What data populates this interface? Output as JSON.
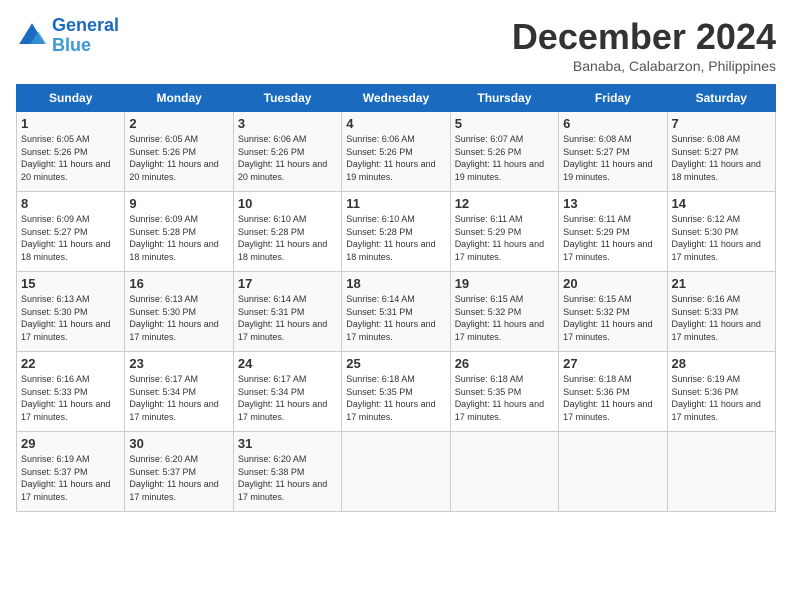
{
  "header": {
    "logo_line1": "General",
    "logo_line2": "Blue",
    "month_title": "December 2024",
    "location": "Banaba, Calabarzon, Philippines"
  },
  "days_of_week": [
    "Sunday",
    "Monday",
    "Tuesday",
    "Wednesday",
    "Thursday",
    "Friday",
    "Saturday"
  ],
  "weeks": [
    [
      {
        "day": "1",
        "sunrise": "6:05 AM",
        "sunset": "5:26 PM",
        "daylight": "11 hours and 20 minutes."
      },
      {
        "day": "2",
        "sunrise": "6:05 AM",
        "sunset": "5:26 PM",
        "daylight": "11 hours and 20 minutes."
      },
      {
        "day": "3",
        "sunrise": "6:06 AM",
        "sunset": "5:26 PM",
        "daylight": "11 hours and 20 minutes."
      },
      {
        "day": "4",
        "sunrise": "6:06 AM",
        "sunset": "5:26 PM",
        "daylight": "11 hours and 19 minutes."
      },
      {
        "day": "5",
        "sunrise": "6:07 AM",
        "sunset": "5:26 PM",
        "daylight": "11 hours and 19 minutes."
      },
      {
        "day": "6",
        "sunrise": "6:08 AM",
        "sunset": "5:27 PM",
        "daylight": "11 hours and 19 minutes."
      },
      {
        "day": "7",
        "sunrise": "6:08 AM",
        "sunset": "5:27 PM",
        "daylight": "11 hours and 18 minutes."
      }
    ],
    [
      {
        "day": "8",
        "sunrise": "6:09 AM",
        "sunset": "5:27 PM",
        "daylight": "11 hours and 18 minutes."
      },
      {
        "day": "9",
        "sunrise": "6:09 AM",
        "sunset": "5:28 PM",
        "daylight": "11 hours and 18 minutes."
      },
      {
        "day": "10",
        "sunrise": "6:10 AM",
        "sunset": "5:28 PM",
        "daylight": "11 hours and 18 minutes."
      },
      {
        "day": "11",
        "sunrise": "6:10 AM",
        "sunset": "5:28 PM",
        "daylight": "11 hours and 18 minutes."
      },
      {
        "day": "12",
        "sunrise": "6:11 AM",
        "sunset": "5:29 PM",
        "daylight": "11 hours and 17 minutes."
      },
      {
        "day": "13",
        "sunrise": "6:11 AM",
        "sunset": "5:29 PM",
        "daylight": "11 hours and 17 minutes."
      },
      {
        "day": "14",
        "sunrise": "6:12 AM",
        "sunset": "5:30 PM",
        "daylight": "11 hours and 17 minutes."
      }
    ],
    [
      {
        "day": "15",
        "sunrise": "6:13 AM",
        "sunset": "5:30 PM",
        "daylight": "11 hours and 17 minutes."
      },
      {
        "day": "16",
        "sunrise": "6:13 AM",
        "sunset": "5:30 PM",
        "daylight": "11 hours and 17 minutes."
      },
      {
        "day": "17",
        "sunrise": "6:14 AM",
        "sunset": "5:31 PM",
        "daylight": "11 hours and 17 minutes."
      },
      {
        "day": "18",
        "sunrise": "6:14 AM",
        "sunset": "5:31 PM",
        "daylight": "11 hours and 17 minutes."
      },
      {
        "day": "19",
        "sunrise": "6:15 AM",
        "sunset": "5:32 PM",
        "daylight": "11 hours and 17 minutes."
      },
      {
        "day": "20",
        "sunrise": "6:15 AM",
        "sunset": "5:32 PM",
        "daylight": "11 hours and 17 minutes."
      },
      {
        "day": "21",
        "sunrise": "6:16 AM",
        "sunset": "5:33 PM",
        "daylight": "11 hours and 17 minutes."
      }
    ],
    [
      {
        "day": "22",
        "sunrise": "6:16 AM",
        "sunset": "5:33 PM",
        "daylight": "11 hours and 17 minutes."
      },
      {
        "day": "23",
        "sunrise": "6:17 AM",
        "sunset": "5:34 PM",
        "daylight": "11 hours and 17 minutes."
      },
      {
        "day": "24",
        "sunrise": "6:17 AM",
        "sunset": "5:34 PM",
        "daylight": "11 hours and 17 minutes."
      },
      {
        "day": "25",
        "sunrise": "6:18 AM",
        "sunset": "5:35 PM",
        "daylight": "11 hours and 17 minutes."
      },
      {
        "day": "26",
        "sunrise": "6:18 AM",
        "sunset": "5:35 PM",
        "daylight": "11 hours and 17 minutes."
      },
      {
        "day": "27",
        "sunrise": "6:18 AM",
        "sunset": "5:36 PM",
        "daylight": "11 hours and 17 minutes."
      },
      {
        "day": "28",
        "sunrise": "6:19 AM",
        "sunset": "5:36 PM",
        "daylight": "11 hours and 17 minutes."
      }
    ],
    [
      {
        "day": "29",
        "sunrise": "6:19 AM",
        "sunset": "5:37 PM",
        "daylight": "11 hours and 17 minutes."
      },
      {
        "day": "30",
        "sunrise": "6:20 AM",
        "sunset": "5:37 PM",
        "daylight": "11 hours and 17 minutes."
      },
      {
        "day": "31",
        "sunrise": "6:20 AM",
        "sunset": "5:38 PM",
        "daylight": "11 hours and 17 minutes."
      },
      null,
      null,
      null,
      null
    ]
  ]
}
